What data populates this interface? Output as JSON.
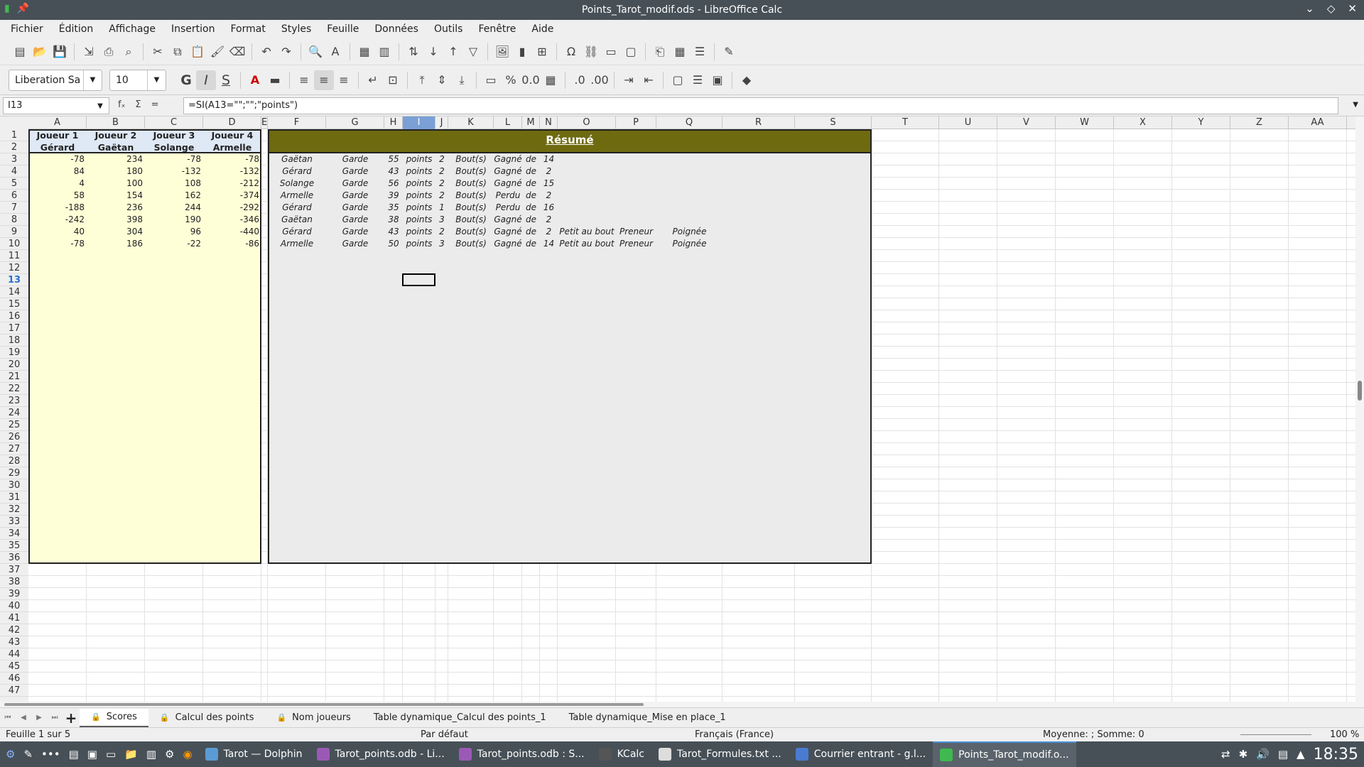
{
  "window": {
    "title": "Points_Tarot_modif.ods - LibreOffice Calc"
  },
  "menu": [
    "Fichier",
    "Édition",
    "Affichage",
    "Insertion",
    "Format",
    "Styles",
    "Feuille",
    "Données",
    "Outils",
    "Fenêtre",
    "Aide"
  ],
  "toolbar": {
    "font_name": "Liberation Sa",
    "font_size": "10",
    "bold": "G",
    "italic": "I",
    "strike": "S",
    "percent": "%"
  },
  "formula_bar": {
    "cell_ref": "I13",
    "formula": "=SI(A13=\"\";\"\";\"points\")",
    "fx": "fₓ",
    "sigma": "Σ",
    "equals": "="
  },
  "columns": [
    "A",
    "B",
    "C",
    "D",
    "E",
    "F",
    "G",
    "H",
    "I",
    "J",
    "K",
    "L",
    "M",
    "N",
    "O",
    "P",
    "Q",
    "R",
    "S",
    "T",
    "U",
    "V",
    "W",
    "X",
    "Y",
    "Z",
    "AA"
  ],
  "selected_column": "I",
  "selected_row": "13",
  "headers": [
    {
      "line1": "Joueur 1",
      "line2": "Gérard"
    },
    {
      "line1": "Joueur 2",
      "line2": "Gaëtan"
    },
    {
      "line1": "Joueur 3",
      "line2": "Solange"
    },
    {
      "line1": "Joueur 4",
      "line2": "Armelle"
    }
  ],
  "resume_title": "Résumé",
  "scores": [
    [
      -78,
      234,
      -78,
      -78
    ],
    [
      84,
      180,
      -132,
      -132
    ],
    [
      4,
      100,
      108,
      -212
    ],
    [
      58,
      154,
      162,
      -374
    ],
    [
      -188,
      236,
      244,
      -292
    ],
    [
      -242,
      398,
      190,
      -346
    ],
    [
      40,
      304,
      96,
      -440
    ],
    [
      -78,
      186,
      -22,
      -86
    ]
  ],
  "summary": [
    [
      "Gaëtan",
      "Garde",
      "55",
      "points",
      "2",
      "Bout(s)",
      "Gagné",
      "de",
      "14",
      "",
      "",
      ""
    ],
    [
      "Gérard",
      "Garde",
      "43",
      "points",
      "2",
      "Bout(s)",
      "Gagné",
      "de",
      "2",
      "",
      "",
      ""
    ],
    [
      "Solange",
      "Garde",
      "56",
      "points",
      "2",
      "Bout(s)",
      "Gagné",
      "de",
      "15",
      "",
      "",
      ""
    ],
    [
      "Armelle",
      "Garde",
      "39",
      "points",
      "2",
      "Bout(s)",
      "Perdu",
      "de",
      "2",
      "",
      "",
      ""
    ],
    [
      "Gérard",
      "Garde",
      "35",
      "points",
      "1",
      "Bout(s)",
      "Perdu",
      "de",
      "16",
      "",
      "",
      ""
    ],
    [
      "Gaëtan",
      "Garde",
      "38",
      "points",
      "3",
      "Bout(s)",
      "Gagné",
      "de",
      "2",
      "",
      "",
      ""
    ],
    [
      "Gérard",
      "Garde",
      "43",
      "points",
      "2",
      "Bout(s)",
      "Gagné",
      "de",
      "2",
      "Petit au bout",
      "Preneur",
      "Poignée"
    ],
    [
      "Armelle",
      "Garde",
      "50",
      "points",
      "3",
      "Bout(s)",
      "Gagné",
      "de",
      "14",
      "Petit au bout",
      "Preneur",
      "Poignée"
    ]
  ],
  "sheet_tabs": [
    "Scores",
    "Calcul des points",
    "Nom joueurs",
    "Table dynamique_Calcul des points_1",
    "Table dynamique_Mise en place_1"
  ],
  "active_tab": "Scores",
  "status": {
    "sheet": "Feuille 1 sur 5",
    "style": "Par défaut",
    "language": "Français (France)",
    "sum": "Moyenne: ; Somme: 0",
    "zoom": "100 %"
  },
  "taskbar": {
    "items": [
      "Tarot — Dolphin",
      "Tarot_points.odb - Li...",
      "Tarot_points.odb : S...",
      "KCalc",
      "Tarot_Formules.txt ...",
      "Courrier entrant - g.l...",
      "Points_Tarot_modif.o..."
    ],
    "clock": "18:35"
  },
  "colors": {
    "header_fill": "#6e6a10",
    "yellow_fill": "#ffffd7",
    "grey_fill": "#ebebeb",
    "selection": "#7aa0d6"
  }
}
